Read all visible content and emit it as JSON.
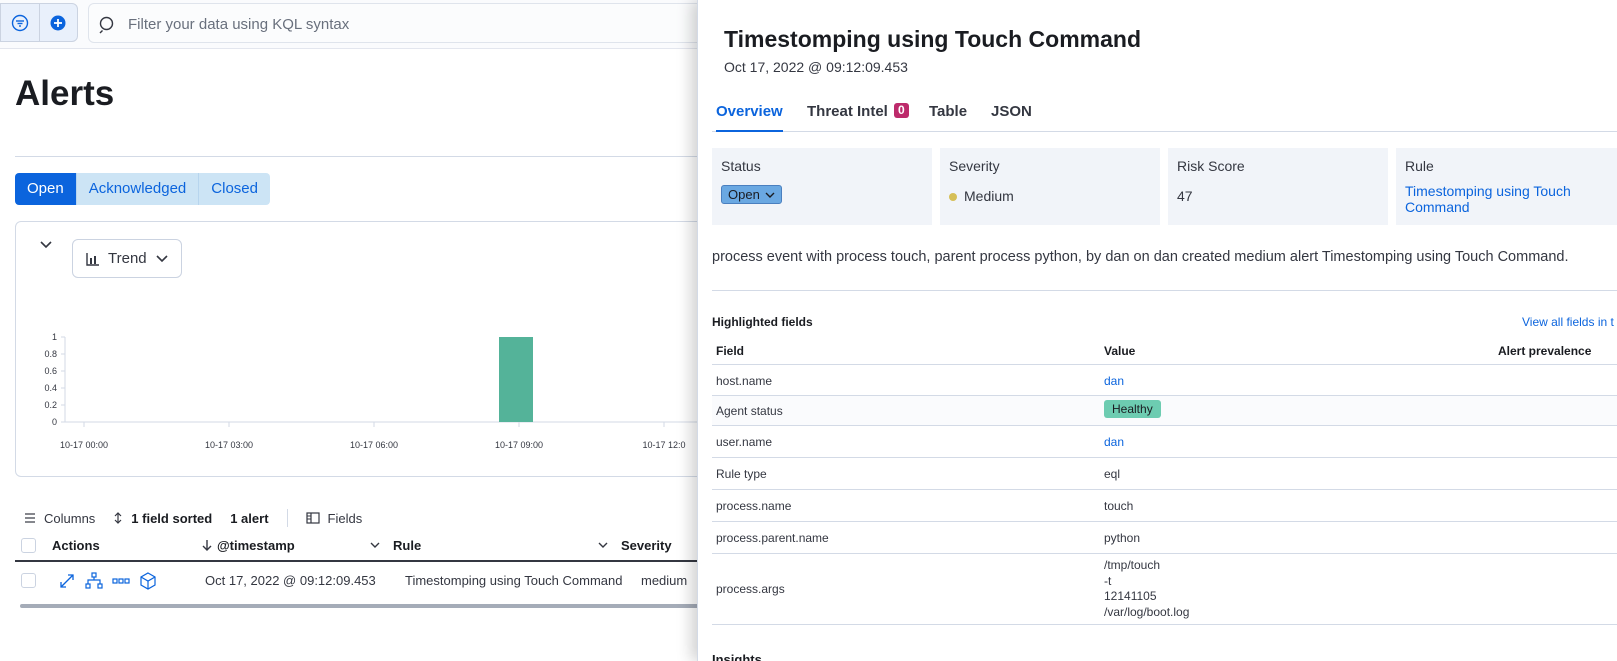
{
  "topbar": {
    "kql_placeholder": "Filter your data using KQL syntax"
  },
  "page": {
    "title": "Alerts",
    "status_filters": [
      "Open",
      "Acknowledged",
      "Closed"
    ],
    "active_filter": "Open"
  },
  "trend": {
    "selector_label": "Trend"
  },
  "chart_data": {
    "type": "bar",
    "x": [
      "10-17 00:00",
      "10-17 03:00",
      "10-17 06:00",
      "10-17 09:00",
      "10-17 12:0"
    ],
    "values": [
      {
        "x": "10-17 09:00",
        "y": 1
      }
    ],
    "ylim": [
      0,
      1
    ],
    "yticks": [
      "1",
      "0.8",
      "0.6",
      "0.4",
      "0.2",
      "0"
    ],
    "bar_color": "#54b399"
  },
  "table": {
    "toolbar": {
      "columns": "Columns",
      "sorted": "1 field sorted",
      "count": "1 alert",
      "fields": "Fields"
    },
    "headers": {
      "actions": "Actions",
      "timestamp": "@timestamp",
      "rule": "Rule",
      "severity": "Severity"
    },
    "rows": [
      {
        "timestamp": "Oct 17, 2022 @ 09:12:09.453",
        "rule": "Timestomping using Touch Command",
        "severity": "medium"
      }
    ]
  },
  "flyout": {
    "title": "Timestomping using Touch Command",
    "date": "Oct 17, 2022 @ 09:12:09.453",
    "tabs": {
      "overview": "Overview",
      "threat_intel": "Threat Intel",
      "threat_intel_count": "0",
      "table": "Table",
      "json": "JSON"
    },
    "cards": {
      "status_label": "Status",
      "status_value": "Open",
      "severity_label": "Severity",
      "severity_value": "Medium",
      "risk_label": "Risk Score",
      "risk_value": "47",
      "rule_label": "Rule",
      "rule_value": "Timestomping using Touch Command"
    },
    "reason": "process event with process touch, parent process python, by dan on dan created medium alert Timestomping using Touch Command.",
    "highlighted": {
      "title": "Highlighted fields",
      "view_all": "View all fields in t",
      "headers": {
        "field": "Field",
        "value": "Value",
        "prevalence": "Alert prevalence"
      },
      "rows": [
        {
          "field": "host.name",
          "value": "dan"
        },
        {
          "field": "Agent status",
          "value": "Healthy"
        },
        {
          "field": "user.name",
          "value": "dan"
        },
        {
          "field": "Rule type",
          "value": "eql"
        },
        {
          "field": "process.name",
          "value": "touch"
        },
        {
          "field": "process.parent.name",
          "value": "python"
        },
        {
          "field": "process.args",
          "value": [
            "/tmp/touch",
            "-t",
            "12141105",
            "/var/log/boot.log"
          ]
        }
      ]
    },
    "bottom_cut": "Insights"
  }
}
